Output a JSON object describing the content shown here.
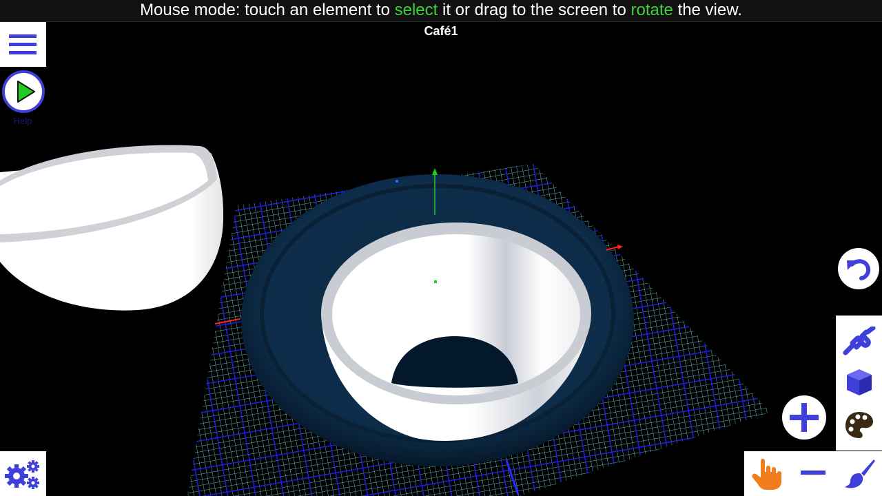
{
  "hint": {
    "part1": "Mouse mode: touch an element to ",
    "select_word": "select",
    "part2": " it or drag to the screen to ",
    "rotate_word": "rotate",
    "part3": " the view."
  },
  "document_title": "Café1",
  "play": {
    "label": "Help"
  },
  "colors": {
    "accent": "#3f3fd9",
    "play_green": "#22cc22",
    "hand_orange": "#f07d1e",
    "highlight_green": "#3cd23c",
    "grid_blue": "#1d1dff",
    "grid_cyan": "#7fe6e6",
    "axis_green": "#22cc22",
    "axis_red": "#ff2222"
  },
  "icons": {
    "menu": "hamburger-icon",
    "play": "play-icon",
    "settings": "gears-icon",
    "undo": "undo-icon",
    "link": "link-icon",
    "cube": "cube-icon",
    "palette": "palette-icon",
    "add": "plus-icon",
    "hand": "pointer-hand-icon",
    "remove": "minus-icon",
    "brush": "brush-icon"
  }
}
